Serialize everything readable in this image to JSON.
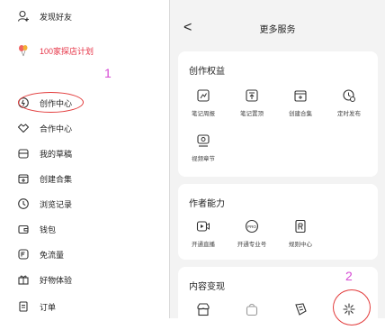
{
  "left_menu": {
    "items": [
      {
        "label": "发现好友",
        "icon": "add-friend-icon"
      },
      {
        "label": "100家探店计划",
        "icon": "balloon-icon"
      },
      {
        "label": "创作中心",
        "icon": "bulb-icon"
      },
      {
        "label": "合作中心",
        "icon": "handshake-icon"
      },
      {
        "label": "我的草稿",
        "icon": "draft-icon"
      },
      {
        "label": "创建合集",
        "icon": "collection-icon"
      },
      {
        "label": "浏览记录",
        "icon": "clock-icon"
      },
      {
        "label": "钱包",
        "icon": "wallet-icon"
      },
      {
        "label": "免流量",
        "icon": "data-free-icon"
      },
      {
        "label": "好物体验",
        "icon": "gift-icon"
      },
      {
        "label": "订单",
        "icon": "order-icon"
      }
    ]
  },
  "annotations": {
    "one": "1",
    "two": "2"
  },
  "header": {
    "back": "<",
    "title": "更多服务"
  },
  "sections": {
    "creator_rights": {
      "title": "创作权益",
      "items": [
        "笔记周报",
        "笔记置顶",
        "创建合集",
        "定时发布",
        "视频章节"
      ]
    },
    "author_abilities": {
      "title": "作者能力",
      "items": [
        "开通直播",
        "开通专业号",
        "规则中心"
      ]
    },
    "monetization": {
      "title": "内容变现"
    }
  },
  "colors": {
    "accent_red": "#e63346",
    "annotation_red": "#e23b3b",
    "annotation_magenta": "#d64bd4"
  }
}
